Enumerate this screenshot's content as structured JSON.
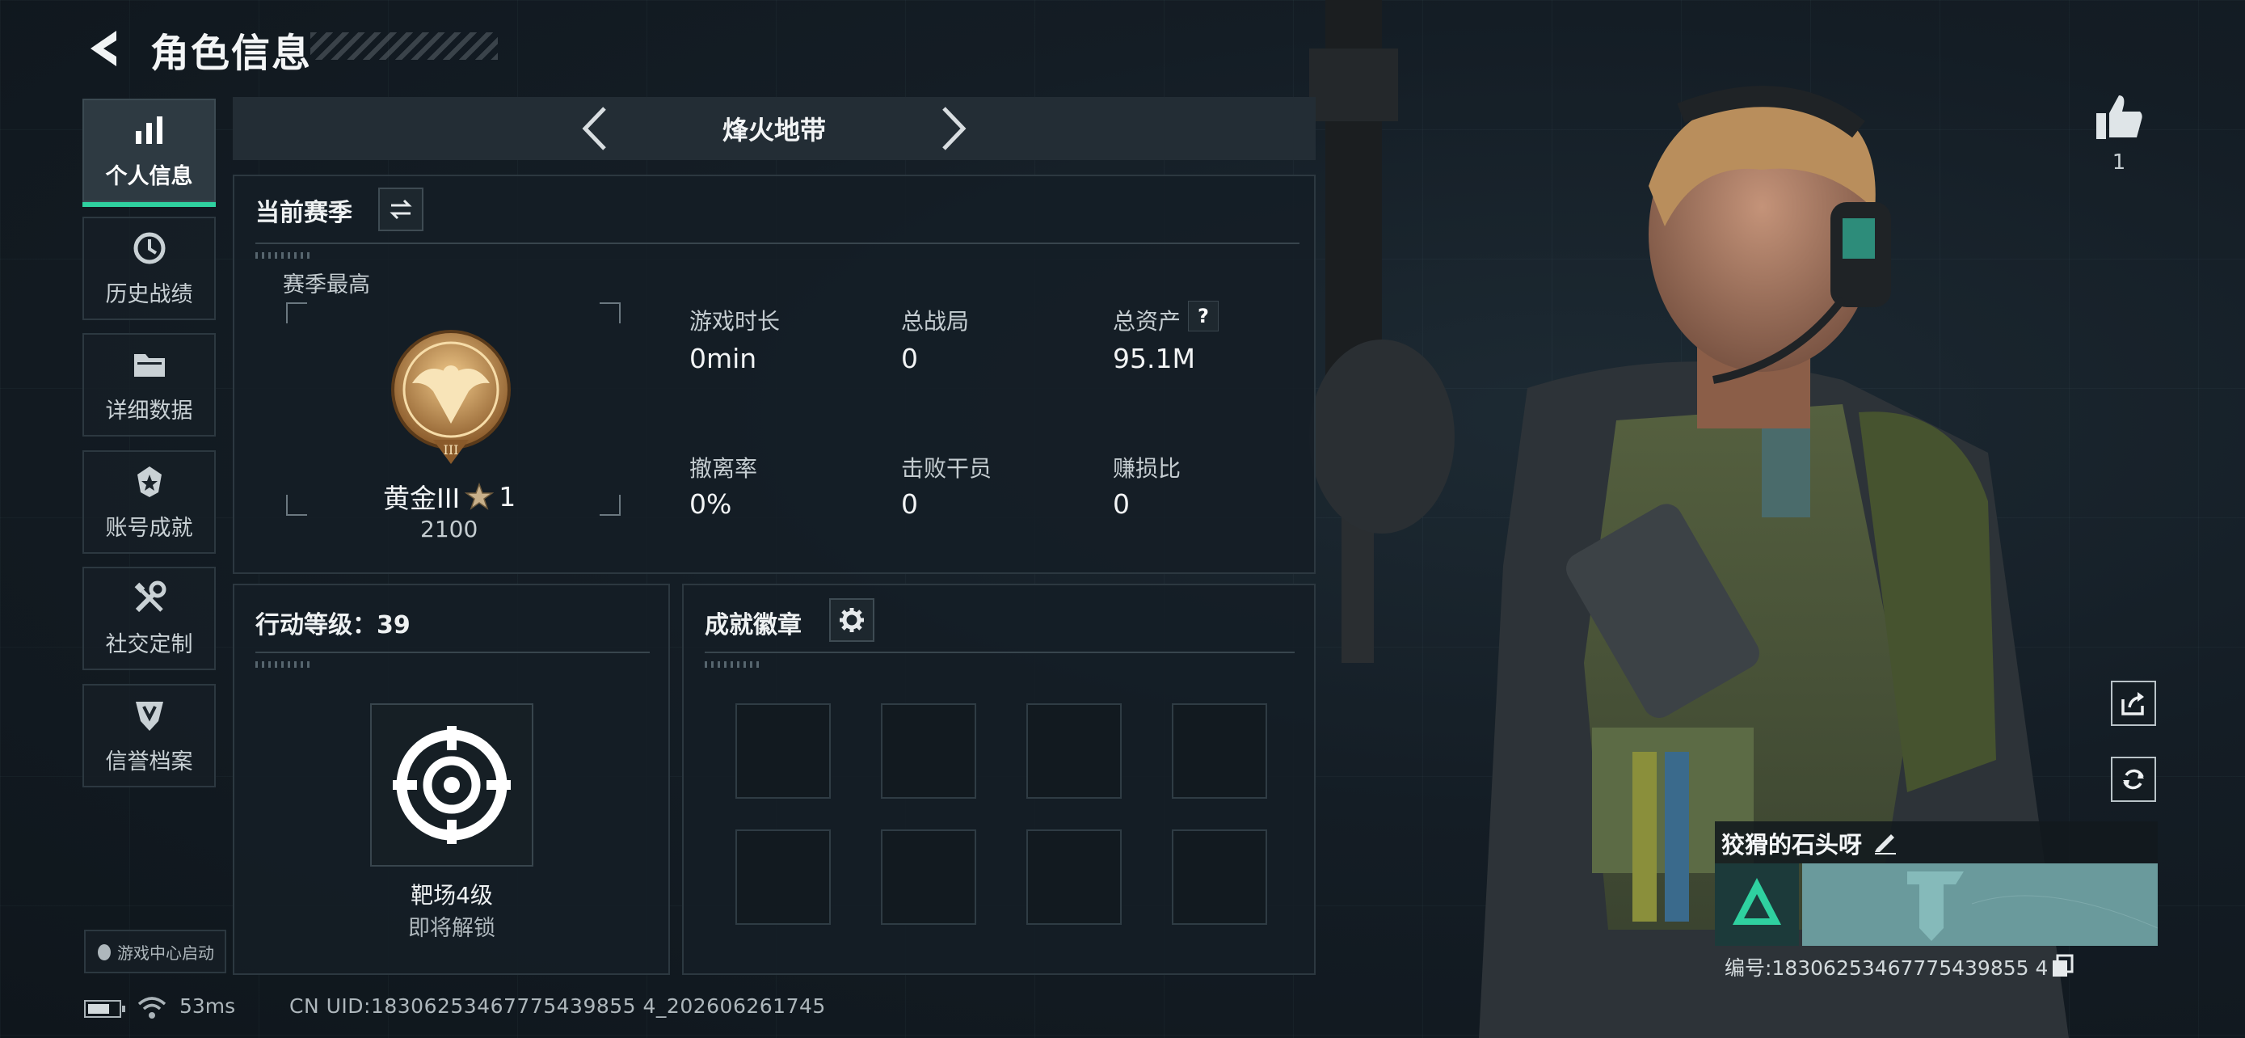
{
  "header": {
    "title": "角色信息"
  },
  "sidebar": {
    "items": [
      {
        "label": "个人信息",
        "icon": "bar-chart-icon",
        "active": true
      },
      {
        "label": "历史战绩",
        "icon": "history-icon",
        "active": false
      },
      {
        "label": "详细数据",
        "icon": "folder-icon",
        "active": false
      },
      {
        "label": "账号成就",
        "icon": "medal-icon",
        "active": false
      },
      {
        "label": "社交定制",
        "icon": "tools-icon",
        "active": false
      },
      {
        "label": "信誉档案",
        "icon": "shield-icon",
        "active": false
      }
    ],
    "game_center": "游戏中心启动"
  },
  "mode": {
    "name": "烽火地带"
  },
  "season": {
    "title": "当前赛季",
    "best_label": "赛季最高",
    "rank_name": "黄金III",
    "rank_stars": "1",
    "rank_score": "2100",
    "stats": [
      {
        "label": "游戏时长",
        "value": "0min"
      },
      {
        "label": "总战局",
        "value": "0"
      },
      {
        "label": "总资产",
        "value": "95.1M",
        "help": "?"
      },
      {
        "label": "撤离率",
        "value": "0%"
      },
      {
        "label": "击败干员",
        "value": "0"
      },
      {
        "label": "赚损比",
        "value": "0"
      }
    ]
  },
  "action_level": {
    "title": "行动等级：39",
    "reward_name": "靶场4级",
    "reward_status": "即将解锁"
  },
  "badges": {
    "title": "成就徽章",
    "slots": 8
  },
  "social": {
    "like_count": "1"
  },
  "player": {
    "name": "狡猾的石头呀",
    "id_line": "编号:18306253467775439855 4"
  },
  "status": {
    "ping": "53ms",
    "uid_line": "CN UID:18306253467775439855 4_202606261745"
  },
  "colors": {
    "accent": "#2fd1a0",
    "card": "#6a9a9c"
  }
}
